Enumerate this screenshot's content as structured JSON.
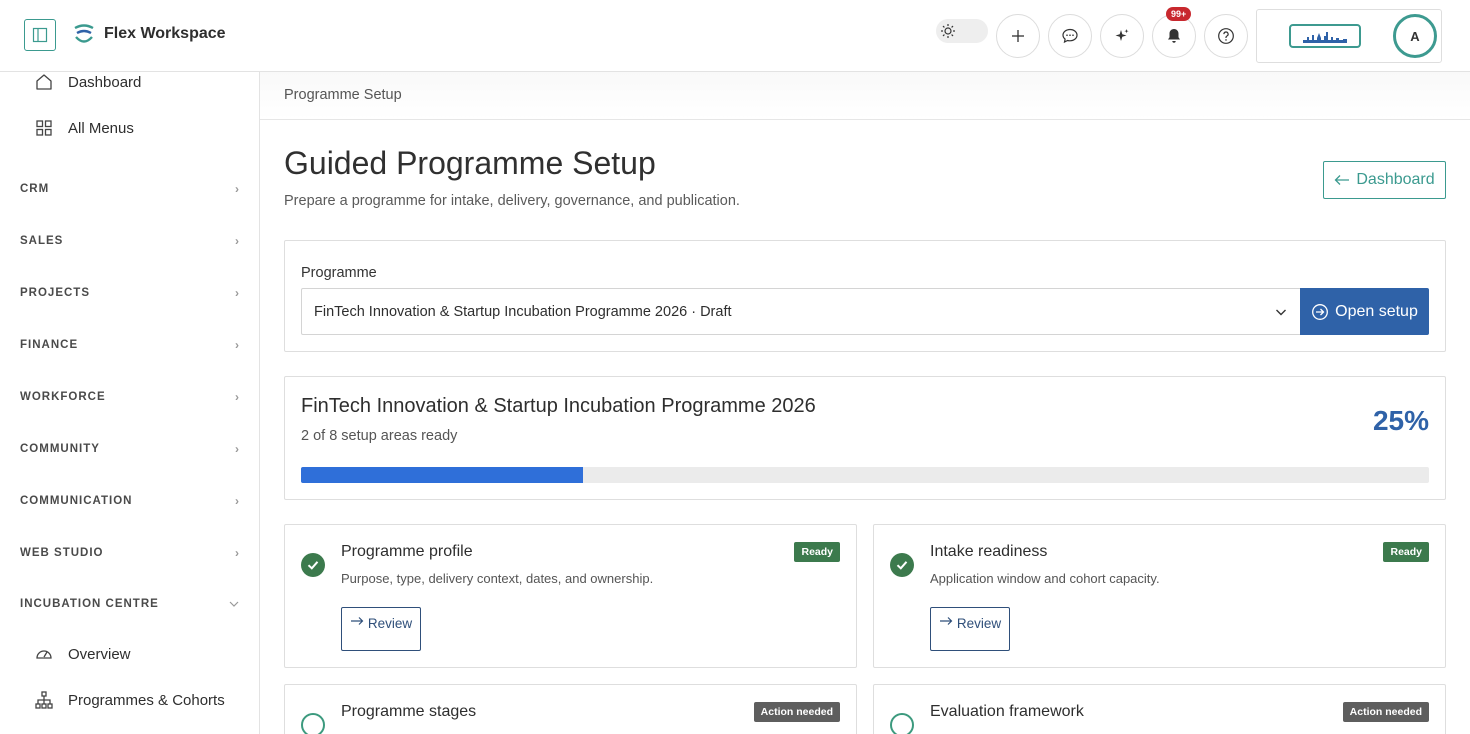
{
  "app": {
    "name": "Flex Workspace"
  },
  "header": {
    "notifications_badge": "99+",
    "avatar_initial": "A"
  },
  "sidebar": {
    "links": [
      {
        "label": "Dashboard",
        "icon": "home-icon"
      },
      {
        "label": "All Menus",
        "icon": "grid-icon"
      }
    ],
    "sections": [
      {
        "label": "CRM"
      },
      {
        "label": "SALES"
      },
      {
        "label": "PROJECTS"
      },
      {
        "label": "FINANCE"
      },
      {
        "label": "WORKFORCE"
      },
      {
        "label": "COMMUNITY"
      },
      {
        "label": "COMMUNICATION"
      },
      {
        "label": "WEB STUDIO"
      },
      {
        "label": "INCUBATION CENTRE",
        "expanded": true
      }
    ],
    "sub_links": [
      {
        "label": "Overview",
        "icon": "gauge-icon"
      },
      {
        "label": "Programmes & Cohorts",
        "icon": "hierarchy-icon"
      }
    ]
  },
  "breadcrumb": "Programme Setup",
  "page": {
    "title": "Guided Programme Setup",
    "subtitle": "Prepare a programme for intake, delivery, governance, and publication.",
    "back_label": "Dashboard"
  },
  "selector": {
    "label": "Programme",
    "value": "FinTech Innovation & Startup Incubation Programme 2026 · Draft",
    "open_label": "Open setup"
  },
  "summary": {
    "title": "FinTech Innovation & Startup Incubation Programme 2026",
    "ready_text": "2 of 8 setup areas ready",
    "percent_label": "25%",
    "progress": 0.25
  },
  "cards": [
    {
      "title": "Programme profile",
      "desc": "Purpose, type, delivery context, dates, and ownership.",
      "status": "Ready",
      "state": "ready",
      "action": "Review"
    },
    {
      "title": "Intake readiness",
      "desc": "Application window and cohort capacity.",
      "status": "Ready",
      "state": "ready",
      "action": "Review"
    },
    {
      "title": "Programme stages",
      "desc": "",
      "status": "Action needed",
      "state": "action",
      "action": ""
    },
    {
      "title": "Evaluation framework",
      "desc": "",
      "status": "Action needed",
      "state": "action",
      "action": ""
    }
  ],
  "colors": {
    "accent": "#3b9a8f",
    "primary": "#2f62a8",
    "ready": "#3c7a4d",
    "progress": "#2f6fd9"
  }
}
